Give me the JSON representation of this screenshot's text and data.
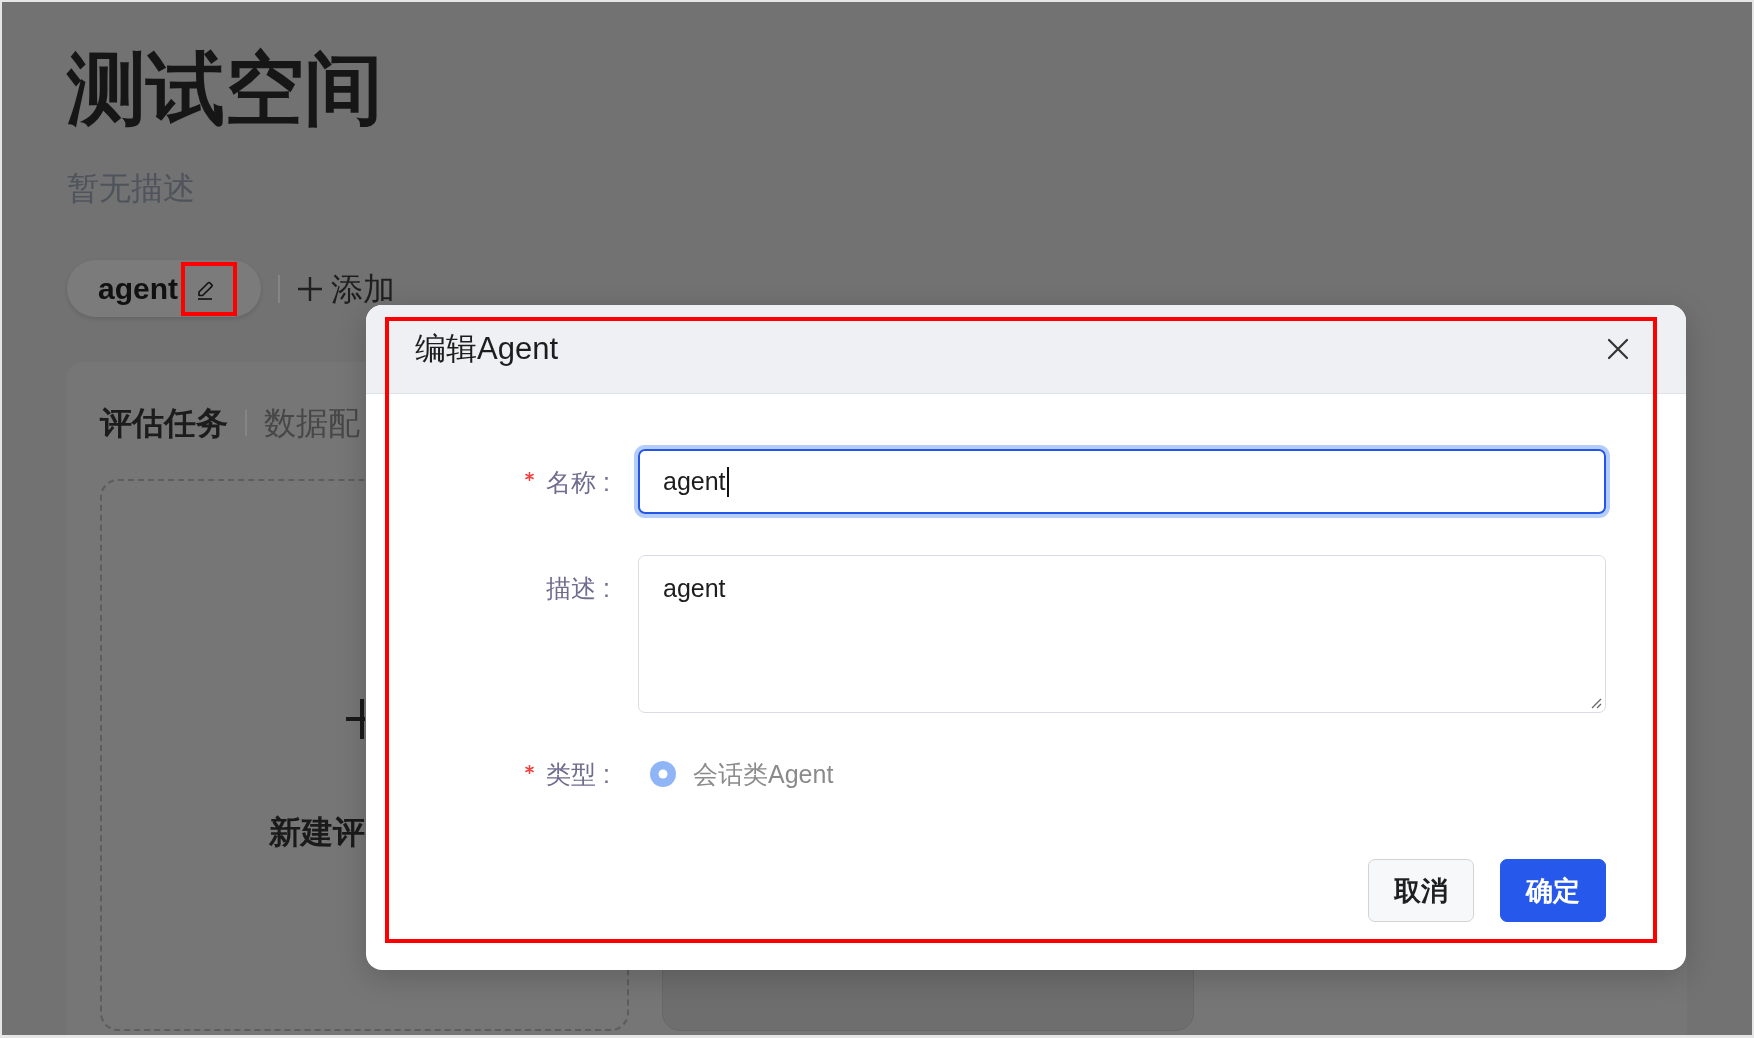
{
  "page": {
    "title": "测试空间",
    "description": "暂无描述"
  },
  "spaces": {
    "items": [
      {
        "label": "agent",
        "selected": true,
        "highlighted": true
      }
    ],
    "add_label": "添加"
  },
  "panel": {
    "tabs": [
      {
        "label": "评估任务",
        "selected": true
      },
      {
        "label": "数据配",
        "selected": false
      }
    ],
    "new_card": {
      "label": "新建评"
    }
  },
  "dialog": {
    "title": "编辑Agent",
    "highlighted": true,
    "fields": [
      {
        "kind": "input",
        "label": "名称 :",
        "required": true,
        "value": "agent",
        "focused": true
      },
      {
        "kind": "textarea",
        "label": "描述 :",
        "required": false,
        "value": "agent",
        "focused": false
      },
      {
        "kind": "radio",
        "label": "类型 :",
        "required": true,
        "options": [
          {
            "label": "会话类Agent",
            "selected": true,
            "disabled": true
          }
        ]
      }
    ],
    "buttons": [
      {
        "label": "取消",
        "kind": "default"
      },
      {
        "label": "确定",
        "kind": "primary"
      }
    ]
  }
}
